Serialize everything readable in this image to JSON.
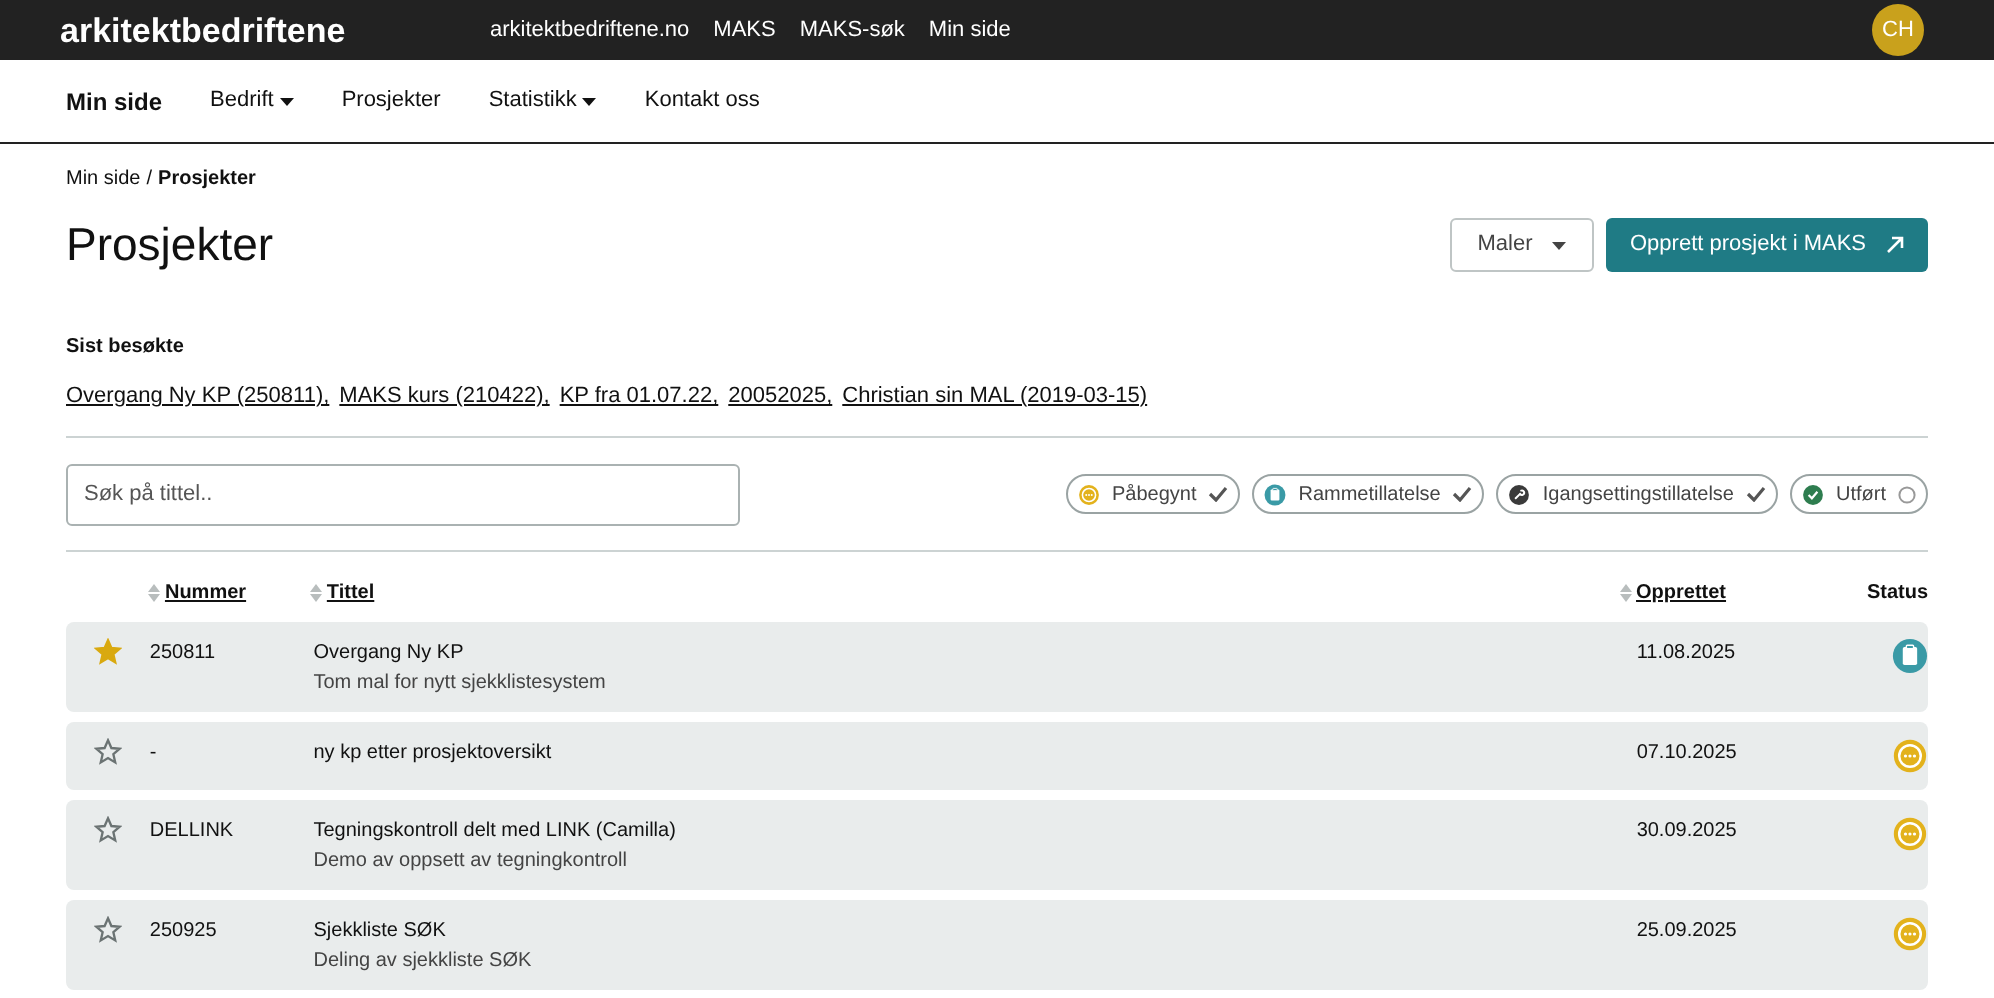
{
  "topbar": {
    "logo": "arkitektbedriftene",
    "links": [
      "arkitektbedriftene.no",
      "MAKS",
      "MAKS-søk",
      "Min side"
    ],
    "avatar": "CH"
  },
  "nav": [
    {
      "label": "Min side",
      "selected": true,
      "dropdown": false
    },
    {
      "label": "Bedrift",
      "selected": false,
      "dropdown": true
    },
    {
      "label": "Prosjekter",
      "selected": false,
      "dropdown": false
    },
    {
      "label": "Statistikk",
      "selected": false,
      "dropdown": true
    },
    {
      "label": "Kontakt oss",
      "selected": false,
      "dropdown": false
    }
  ],
  "breadcrumb": {
    "parent": "Min side",
    "separator": "/",
    "current": "Prosjekter"
  },
  "title": "Prosjekter",
  "buttons": {
    "templates": "Maler",
    "create": "Opprett prosjekt i MAKS"
  },
  "recent": {
    "heading": "Sist besøkte",
    "links": [
      "Overgang Ny KP (250811),",
      "MAKS kurs (210422),",
      "KP fra 01.07.22,",
      "20052025,",
      "Christian sin MAL (2019-03-15)"
    ]
  },
  "search": {
    "placeholder": "Søk på tittel.."
  },
  "filters": [
    {
      "label": "Påbegynt",
      "kind": "started",
      "checked": true
    },
    {
      "label": "Rammetillatelse",
      "kind": "framework",
      "checked": true
    },
    {
      "label": "Igangsettingstillatelse",
      "kind": "commencement",
      "checked": true
    },
    {
      "label": "Utført",
      "kind": "done",
      "checked": false
    }
  ],
  "table": {
    "columns": [
      "Nummer",
      "Tittel",
      "Opprettet",
      "Status"
    ],
    "rows": [
      {
        "favorite": true,
        "number": "250811",
        "title": "Overgang Ny KP",
        "subtitle": "Tom mal for nytt sjekklistesystem",
        "created": "11.08.2025",
        "kind": "framework"
      },
      {
        "favorite": false,
        "number": "-",
        "title": "ny kp etter prosjektoversikt",
        "created": "07.10.2025",
        "kind": "started"
      },
      {
        "favorite": false,
        "number": "DELLINK",
        "title": "Tegningskontroll delt med LINK (Camilla)",
        "subtitle": "Demo av oppsett av tegningkontroll",
        "created": "30.09.2025",
        "kind": "started"
      },
      {
        "favorite": false,
        "number": "250925",
        "title": "Sjekkliste SØK",
        "subtitle": "Deling av sjekkliste SØK",
        "created": "25.09.2025",
        "kind": "started"
      }
    ]
  }
}
